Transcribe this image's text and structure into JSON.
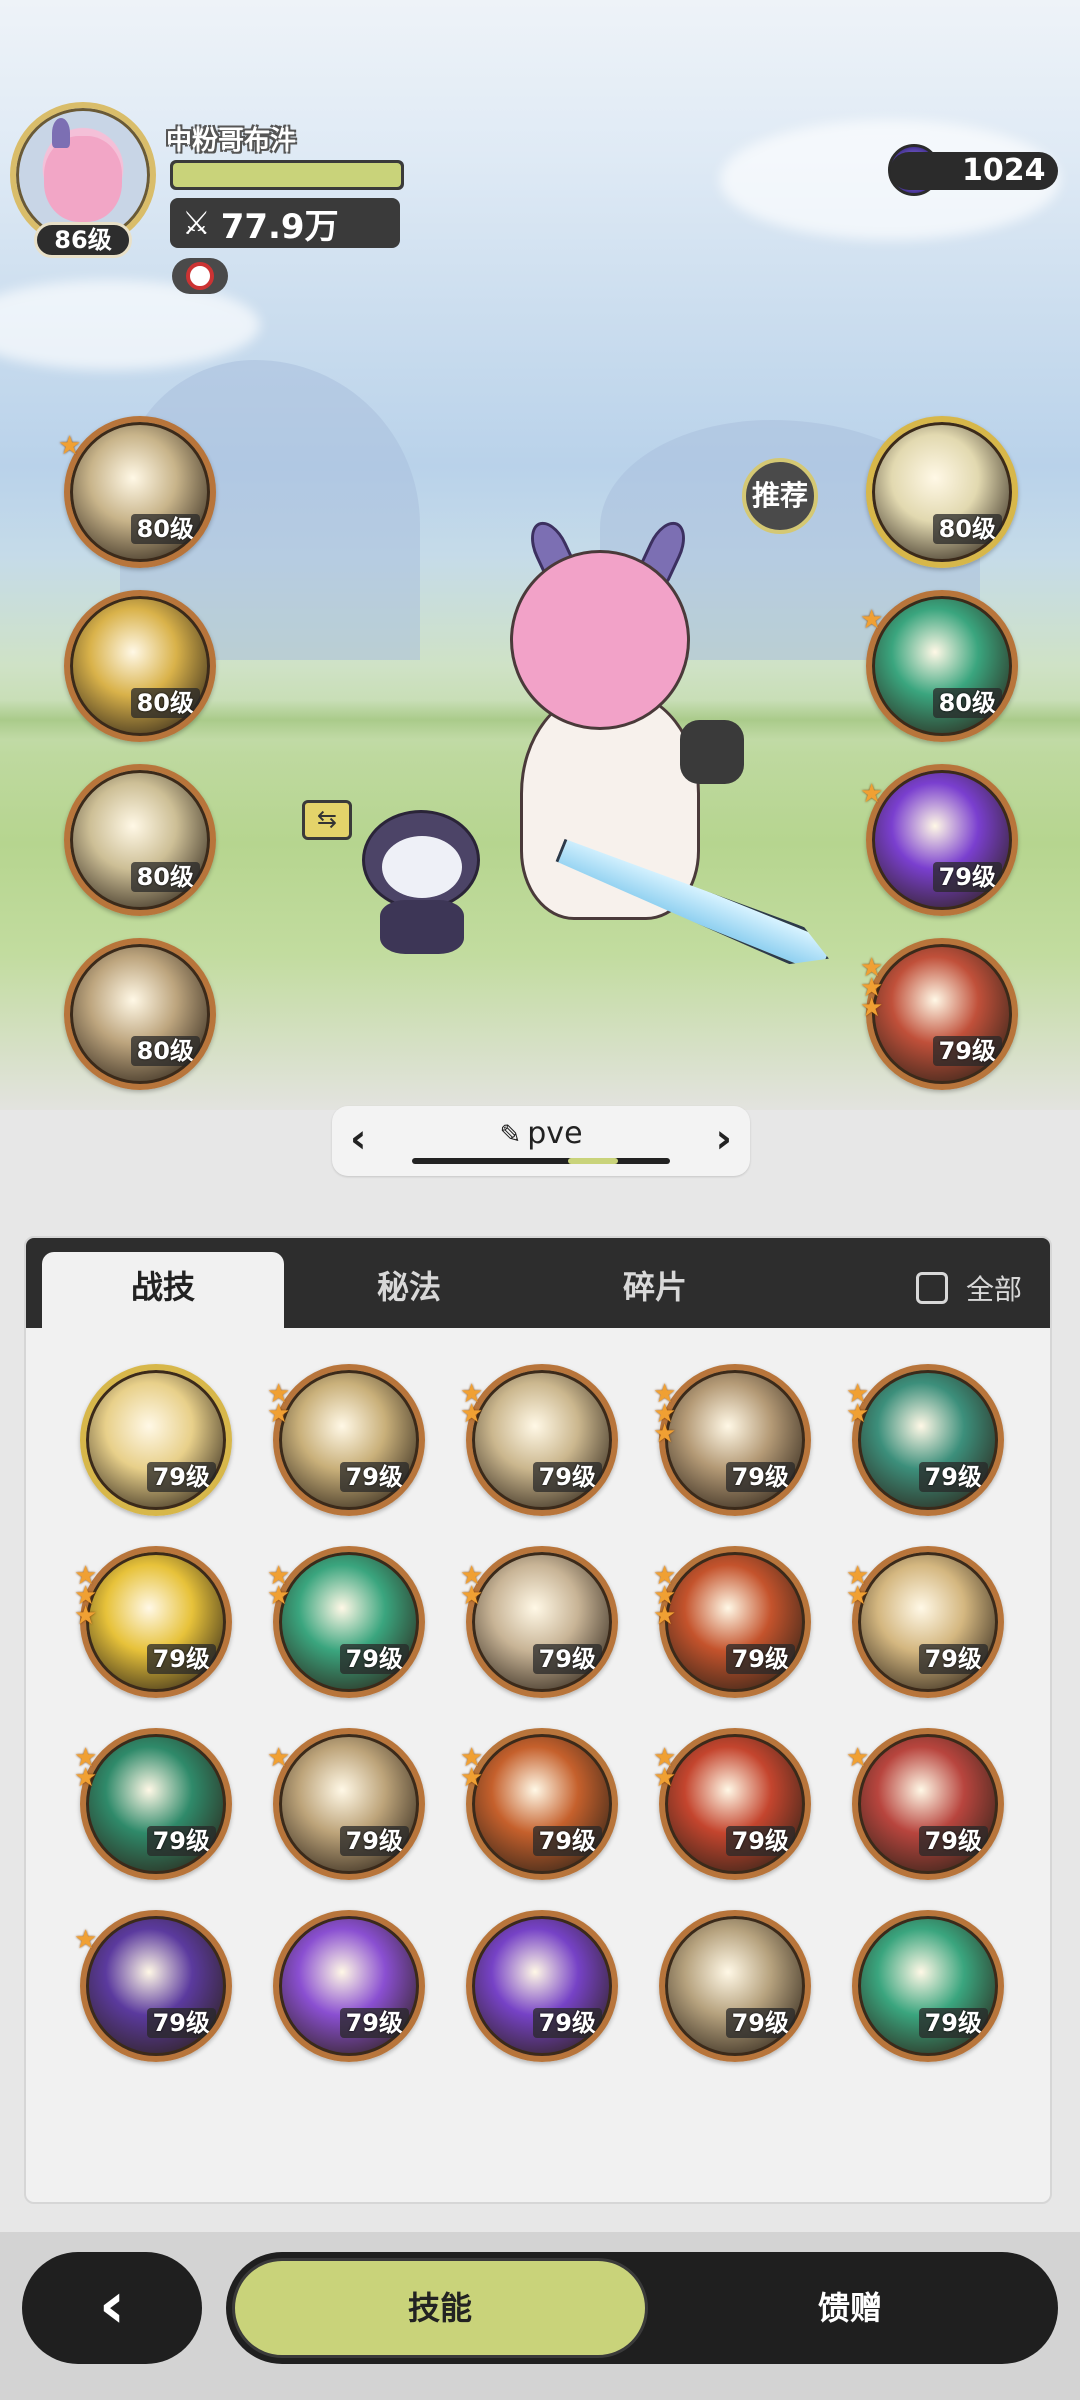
{
  "player": {
    "name": "中粉哥布汼",
    "level": "86级",
    "power": "77.9万"
  },
  "currency": {
    "amount": "1024"
  },
  "recommend_label": "推荐",
  "left_skills": [
    {
      "level": "80级",
      "stars": 1,
      "theme": "#c8b48a"
    },
    {
      "level": "80级",
      "stars": 0,
      "theme": "#d9b24a"
    },
    {
      "level": "80级",
      "stars": 0,
      "theme": "#cdbf96"
    },
    {
      "level": "80级",
      "stars": 0,
      "theme": "#bda57e"
    }
  ],
  "right_skills": [
    {
      "level": "80级",
      "stars": 0,
      "theme": "#e2d9b0",
      "gold": true
    },
    {
      "level": "80级",
      "stars": 1,
      "theme": "#3aa57e"
    },
    {
      "level": "79级",
      "stars": 1,
      "theme": "#7a3fcf"
    },
    {
      "level": "79级",
      "stars": 3,
      "theme": "#c0503a"
    }
  ],
  "loadout": {
    "name": "pve"
  },
  "tabs": {
    "t1": "战技",
    "t2": "秘法",
    "t3": "碎片",
    "all": "全部"
  },
  "grid_skills": [
    {
      "level": "79级",
      "stars": 0,
      "theme": "#e8d08a",
      "gold": true
    },
    {
      "level": "79级",
      "stars": 2,
      "theme": "#c9b07a"
    },
    {
      "level": "79级",
      "stars": 2,
      "theme": "#cbb78e"
    },
    {
      "level": "79级",
      "stars": 3,
      "theme": "#b49a76"
    },
    {
      "level": "79级",
      "stars": 2,
      "theme": "#3c8f7b"
    },
    {
      "level": "79级",
      "stars": 3,
      "theme": "#e7c23a"
    },
    {
      "level": "79级",
      "stars": 2,
      "theme": "#3aa57e"
    },
    {
      "level": "79级",
      "stars": 2,
      "theme": "#c8b496"
    },
    {
      "level": "79级",
      "stars": 3,
      "theme": "#c4532c"
    },
    {
      "level": "79级",
      "stars": 2,
      "theme": "#d4b780"
    },
    {
      "level": "79级",
      "stars": 2,
      "theme": "#2f8a6a"
    },
    {
      "level": "79级",
      "stars": 1,
      "theme": "#bda47a"
    },
    {
      "level": "79级",
      "stars": 2,
      "theme": "#c5602c"
    },
    {
      "level": "79级",
      "stars": 2,
      "theme": "#c4452e"
    },
    {
      "level": "79级",
      "stars": 1,
      "theme": "#b8453e"
    },
    {
      "level": "79级",
      "stars": 1,
      "theme": "#5b3a9e"
    },
    {
      "level": "79级",
      "stars": 0,
      "theme": "#8a4fd1"
    },
    {
      "level": "79级",
      "stars": 0,
      "theme": "#7642c6"
    },
    {
      "level": "79级",
      "stars": 0,
      "theme": "#b6a27e"
    },
    {
      "level": "79级",
      "stars": 0,
      "theme": "#3aa57e"
    }
  ],
  "bottom": {
    "back": "‹",
    "mode_skills": "技能",
    "mode_gift": "馈赠"
  }
}
